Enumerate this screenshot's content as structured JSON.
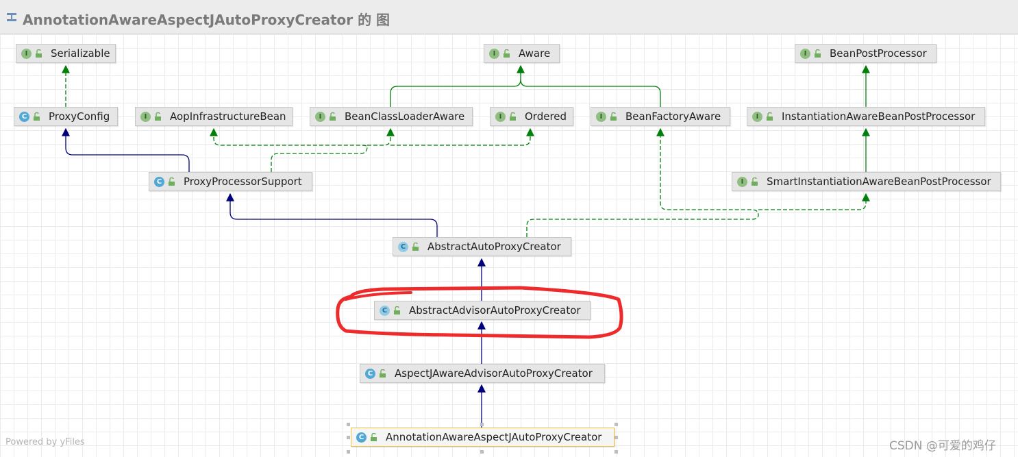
{
  "window": {
    "title": "AnnotationAwareAspectJAutoProxyCreator 的 图"
  },
  "nodes": [
    {
      "id": "serializable",
      "label": "Serializable",
      "kind": "interface"
    },
    {
      "id": "aware",
      "label": "Aware",
      "kind": "interface"
    },
    {
      "id": "bean_post_processor",
      "label": "BeanPostProcessor",
      "kind": "interface"
    },
    {
      "id": "proxy_config",
      "label": "ProxyConfig",
      "kind": "class"
    },
    {
      "id": "aop_infrastructure_bean",
      "label": "AopInfrastructureBean",
      "kind": "interface"
    },
    {
      "id": "bean_class_loader_aware",
      "label": "BeanClassLoaderAware",
      "kind": "interface"
    },
    {
      "id": "ordered",
      "label": "Ordered",
      "kind": "interface"
    },
    {
      "id": "bean_factory_aware",
      "label": "BeanFactoryAware",
      "kind": "interface"
    },
    {
      "id": "instantiation_aware_bpp",
      "label": "InstantiationAwareBeanPostProcessor",
      "kind": "interface"
    },
    {
      "id": "proxy_processor_support",
      "label": "ProxyProcessorSupport",
      "kind": "class"
    },
    {
      "id": "smart_instantiation_aware_bpp",
      "label": "SmartInstantiationAwareBeanPostProcessor",
      "kind": "interface"
    },
    {
      "id": "abstract_auto_proxy_creator",
      "label": "AbstractAutoProxyCreator",
      "kind": "abstract-class"
    },
    {
      "id": "abstract_advisor_auto_proxy_creator",
      "label": "AbstractAdvisorAutoProxyCreator",
      "kind": "abstract-class",
      "highlighted": true
    },
    {
      "id": "aspectj_aware_advisor_auto_proxy_creator",
      "label": "AspectJAwareAdvisorAutoProxyCreator",
      "kind": "class"
    },
    {
      "id": "annotation_aware_aspectj_auto_proxy_creator",
      "label": "AnnotationAwareAspectJAutoProxyCreator",
      "kind": "class",
      "selected": true
    }
  ],
  "edges": [
    {
      "from": "proxy_config",
      "to": "serializable",
      "type": "implements"
    },
    {
      "from": "bean_class_loader_aware",
      "to": "aware",
      "type": "extends-interface"
    },
    {
      "from": "bean_factory_aware",
      "to": "aware",
      "type": "extends-interface"
    },
    {
      "from": "instantiation_aware_bpp",
      "to": "bean_post_processor",
      "type": "extends-interface"
    },
    {
      "from": "smart_instantiation_aware_bpp",
      "to": "instantiation_aware_bpp",
      "type": "extends-interface"
    },
    {
      "from": "proxy_processor_support",
      "to": "proxy_config",
      "type": "extends"
    },
    {
      "from": "proxy_processor_support",
      "to": "aop_infrastructure_bean",
      "type": "implements"
    },
    {
      "from": "proxy_processor_support",
      "to": "bean_class_loader_aware",
      "type": "implements"
    },
    {
      "from": "proxy_processor_support",
      "to": "ordered",
      "type": "implements"
    },
    {
      "from": "abstract_auto_proxy_creator",
      "to": "proxy_processor_support",
      "type": "extends"
    },
    {
      "from": "abstract_auto_proxy_creator",
      "to": "bean_factory_aware",
      "type": "implements"
    },
    {
      "from": "abstract_auto_proxy_creator",
      "to": "smart_instantiation_aware_bpp",
      "type": "implements"
    },
    {
      "from": "abstract_advisor_auto_proxy_creator",
      "to": "abstract_auto_proxy_creator",
      "type": "extends"
    },
    {
      "from": "aspectj_aware_advisor_auto_proxy_creator",
      "to": "abstract_advisor_auto_proxy_creator",
      "type": "extends"
    },
    {
      "from": "annotation_aware_aspectj_auto_proxy_creator",
      "to": "aspectj_aware_advisor_auto_proxy_creator",
      "type": "extends"
    }
  ],
  "icons": {
    "interface": "I",
    "class": "C",
    "abstract_class": "C",
    "access": "unlock-icon"
  },
  "colors": {
    "extends": "#00007f",
    "implements": "#00800a",
    "highlight": "#ee2222",
    "grid": "#ebebeb",
    "node_fill": "#e6e6e6"
  },
  "footer": {
    "powered_by": "Powered by yFiles",
    "watermark": "CSDN @可爱的鸡仔"
  }
}
